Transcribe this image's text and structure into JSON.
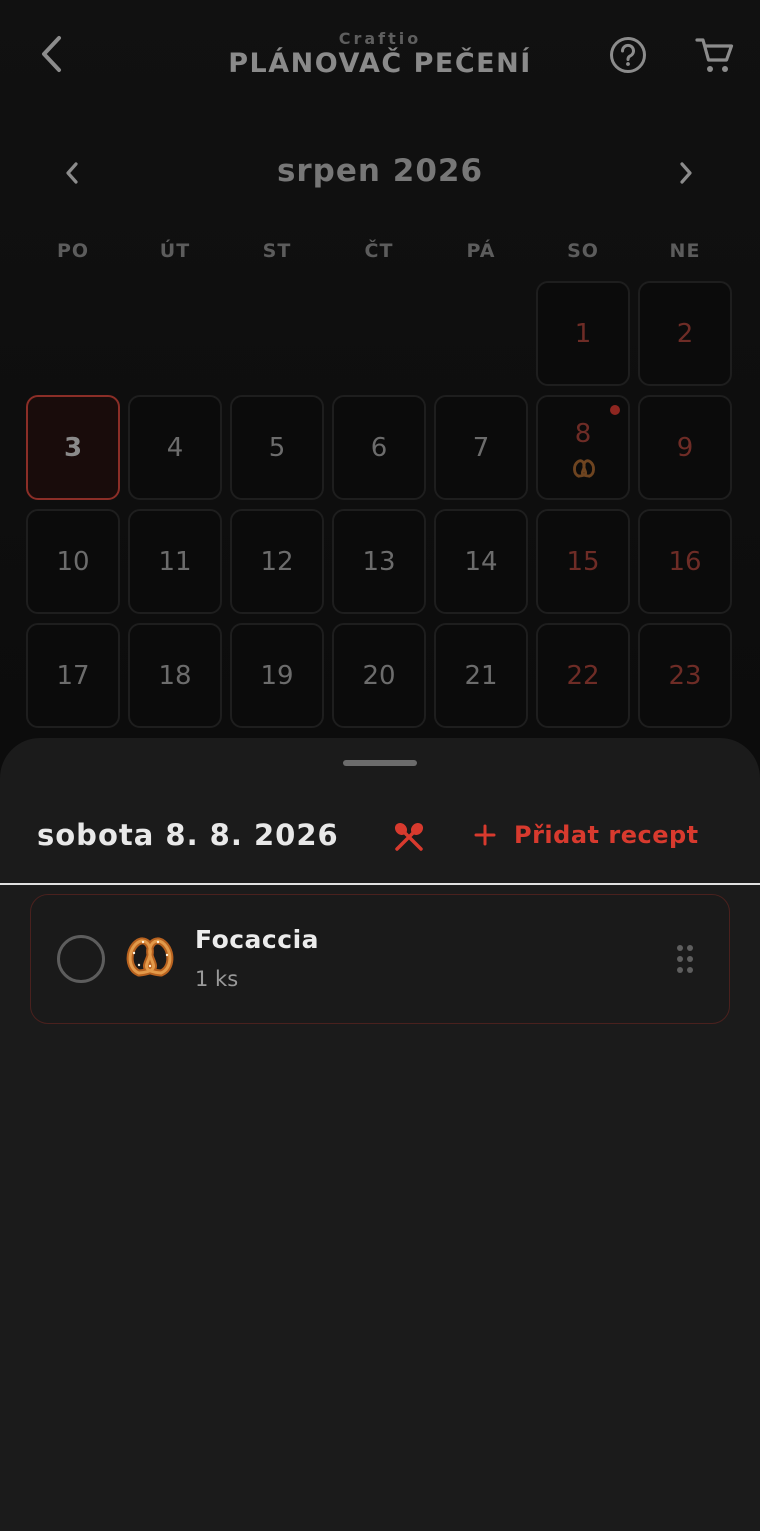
{
  "header": {
    "brand": "Craftio",
    "title": "PLÁNOVAČ PEČENÍ",
    "back_icon": "chevron-left-icon",
    "help_icon": "help-circle-icon",
    "cart_icon": "shopping-cart-icon"
  },
  "calendar": {
    "month_label": "srpen 2026",
    "weekdays": [
      "PO",
      "ÚT",
      "ST",
      "ČT",
      "PÁ",
      "SO",
      "NE"
    ],
    "today": 3,
    "selected": 8,
    "weeks": [
      [
        null,
        null,
        null,
        null,
        null,
        1,
        2
      ],
      [
        3,
        4,
        5,
        6,
        7,
        8,
        9
      ],
      [
        10,
        11,
        12,
        13,
        14,
        15,
        16
      ],
      [
        17,
        18,
        19,
        20,
        21,
        22,
        23
      ]
    ],
    "planned_days": [
      8
    ]
  },
  "sheet": {
    "title": "sobota 8. 8. 2026",
    "add_label": "Přidat recept",
    "items": [
      {
        "name": "Focaccia",
        "quantity": "1 ks",
        "icon": "pretzel-icon",
        "checked": false
      }
    ]
  },
  "colors": {
    "accent": "#d83a2e",
    "background": "#0b0b0b",
    "sheet": "#1b1b1b",
    "weekend": "#6e2c26"
  }
}
